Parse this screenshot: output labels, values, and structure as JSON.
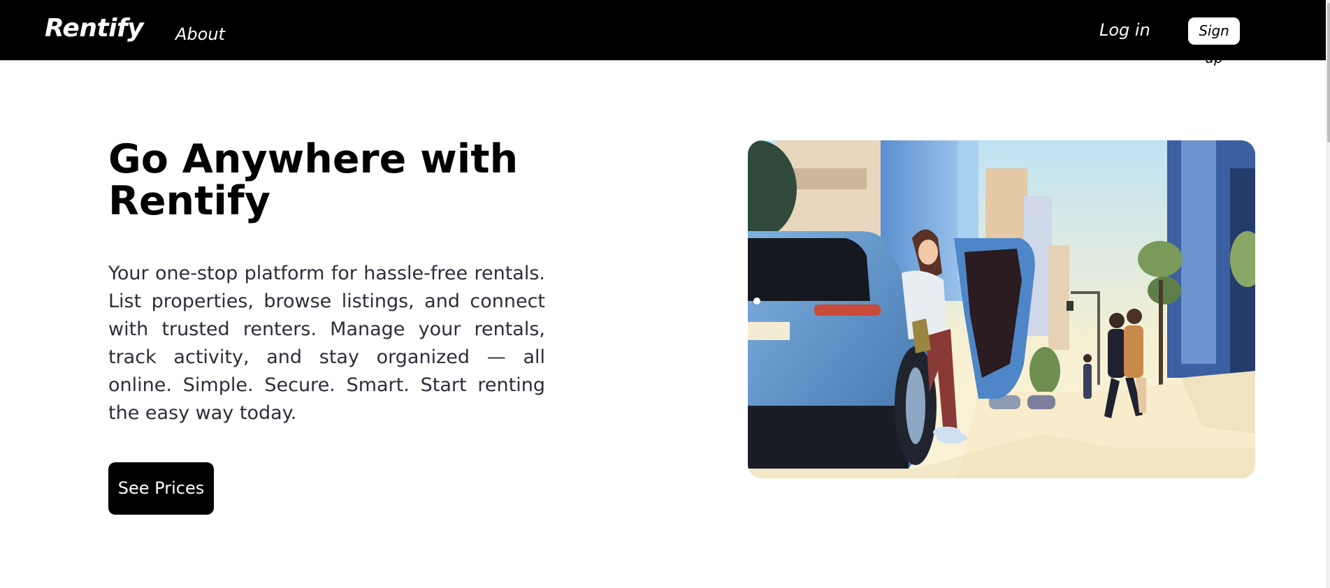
{
  "nav": {
    "brand": "Rentify",
    "about": "About",
    "login": "Log in",
    "signup": "Sign up"
  },
  "hero": {
    "title": "Go Anywhere with Rentify",
    "description": "Your one-stop platform for hassle-free rentals. List properties, browse listings, and connect with trusted renters. Manage your rentals, track activity, and stay organized — all online. Simple. Secure. Smart. Start renting the easy way today.",
    "cta": "See Prices",
    "image_alt": "Illustration of a woman stepping out of a blue car on a sunny city street"
  },
  "colors": {
    "nav_bg": "#000000",
    "text_primary": "#000000",
    "text_body": "#2d2d3a",
    "button_bg": "#000000"
  }
}
